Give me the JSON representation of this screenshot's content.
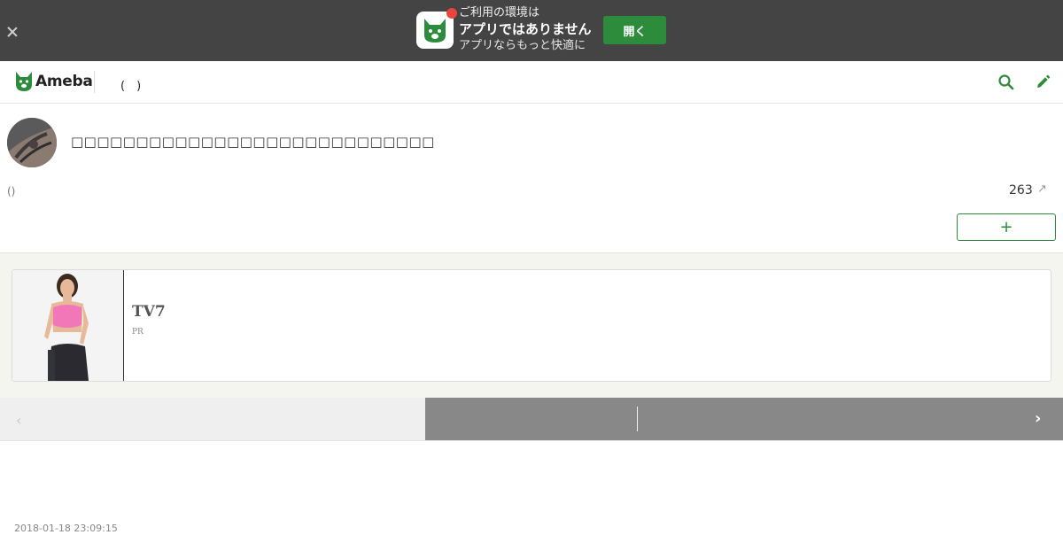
{
  "app_banner": {
    "line1": "ご利用の環境は",
    "line2": "アプリではありません",
    "line3": "アプリならもっと快適に",
    "open_label": "開く"
  },
  "header": {
    "logo_text": "Ameba",
    "blog_title": "(　)"
  },
  "entry": {
    "title": "□□□□□□□□□□□□□□□□□□□□□□□□□□□□",
    "theme": "()",
    "like_count": "263",
    "share_icon": "↗",
    "follow_label": "+"
  },
  "ad": {
    "title": "TV7",
    "pr_label": "PR"
  },
  "pager": {
    "prev_icon": "‹",
    "next_icon": "›"
  },
  "timestamp": "2018-01-18 23:09:15",
  "colors": {
    "brand_green": "#2d8c3c",
    "banner_bg": "#444444",
    "notification_red": "#e8463a",
    "pager_next_bg": "#888888"
  }
}
